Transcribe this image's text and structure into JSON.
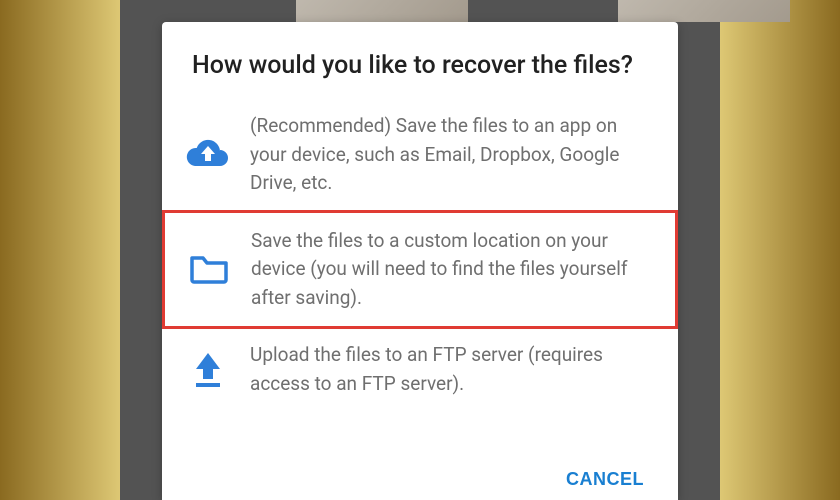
{
  "dialog": {
    "title": "How would you like to recover the files?",
    "options": [
      {
        "icon": "cloud-upload-icon",
        "text": "(Recommended) Save the files to an app on your device, such as Email, Dropbox, Google Drive, etc."
      },
      {
        "icon": "folder-icon",
        "text": "Save the files to a custom location on your device (you will need to find the files yourself after saving)."
      },
      {
        "icon": "upload-icon",
        "text": "Upload the files to an FTP server (requires access to an FTP server)."
      }
    ],
    "actions": {
      "cancel": "CANCEL"
    }
  },
  "colors": {
    "accent": "#2f7fd9",
    "highlight_border": "#e03b33"
  }
}
